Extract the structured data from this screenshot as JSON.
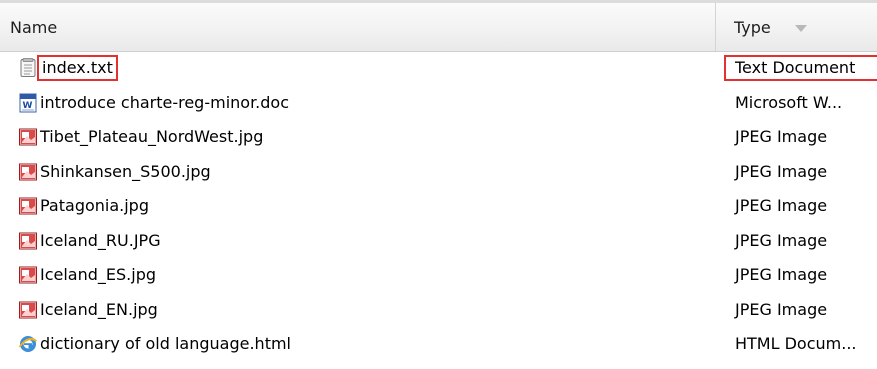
{
  "header": {
    "name_label": "Name",
    "type_label": "Type"
  },
  "files": [
    {
      "name": "index.txt",
      "type": "Text Document",
      "icon": "text-file-icon",
      "selected": true
    },
    {
      "name": "introduce charte-reg-minor.doc",
      "type": "Microsoft W...",
      "icon": "word-document-icon",
      "selected": false
    },
    {
      "name": "Tibet_Plateau_NordWest.jpg",
      "type": "JPEG Image",
      "icon": "jpeg-image-icon",
      "selected": false
    },
    {
      "name": "Shinkansen_S500.jpg",
      "type": "JPEG Image",
      "icon": "jpeg-image-icon",
      "selected": false
    },
    {
      "name": "Patagonia.jpg",
      "type": "JPEG Image",
      "icon": "jpeg-image-icon",
      "selected": false
    },
    {
      "name": "Iceland_RU.JPG",
      "type": "JPEG Image",
      "icon": "jpeg-image-icon",
      "selected": false
    },
    {
      "name": "Iceland_ES.jpg",
      "type": "JPEG Image",
      "icon": "jpeg-image-icon",
      "selected": false
    },
    {
      "name": "Iceland_EN.jpg",
      "type": "JPEG Image",
      "icon": "jpeg-image-icon",
      "selected": false
    },
    {
      "name": "dictionary of old language.html",
      "type": "HTML Docum...",
      "icon": "html-document-icon",
      "selected": false
    }
  ],
  "colors": {
    "highlight_border": "#e53030",
    "header_bg": "#f1f1f1"
  }
}
